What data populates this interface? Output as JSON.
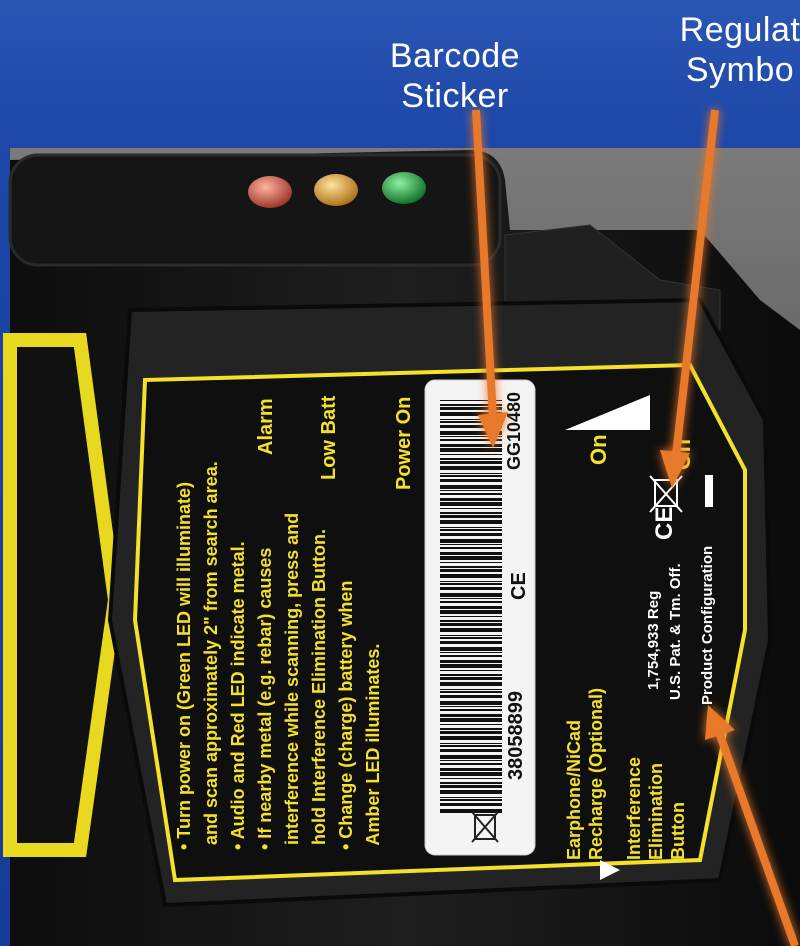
{
  "callouts": {
    "barcode": "Barcode\nSticker",
    "regulatory": "Regulat\nSymbo"
  },
  "leds": [
    {
      "name": "red",
      "color": "#d86a5a"
    },
    {
      "name": "amber",
      "color": "#e3a33a"
    },
    {
      "name": "green",
      "color": "#17a23c"
    }
  ],
  "label": {
    "instructions": [
      "• Turn power on (Green LED will illuminate)",
      "  and scan approximately 2\" from search area.",
      "• Audio and Red LED indicate metal.",
      "• If nearby metal (e.g. rebar) causes",
      "  interference while scanning, press and",
      "  hold Interference Elimination Button.",
      "• Change (charge) battery when",
      "  Amber LED illuminates."
    ],
    "led_legend": [
      "Alarm",
      "Low Batt",
      "Power On"
    ],
    "switch_on": "On",
    "switch_off": "Off",
    "earphone": [
      "Earphone/NiCad",
      "Recharge (Optional)"
    ],
    "interference_button": [
      "Interference",
      "Elimination",
      "Button"
    ],
    "patent": [
      "1,754,933 Reg",
      "U.S. Pat. & Tm. Off.",
      "Product Configuration"
    ],
    "ce_mark": "CE"
  },
  "barcode_sticker": {
    "code_top": "GG10480",
    "code_bottom": "38058899",
    "ce_mark": "CE"
  },
  "colors": {
    "background": "#1d47a8",
    "arrow": "#e8782a",
    "label_border": "#f3e12a",
    "device_body": "#1a1a1a"
  }
}
